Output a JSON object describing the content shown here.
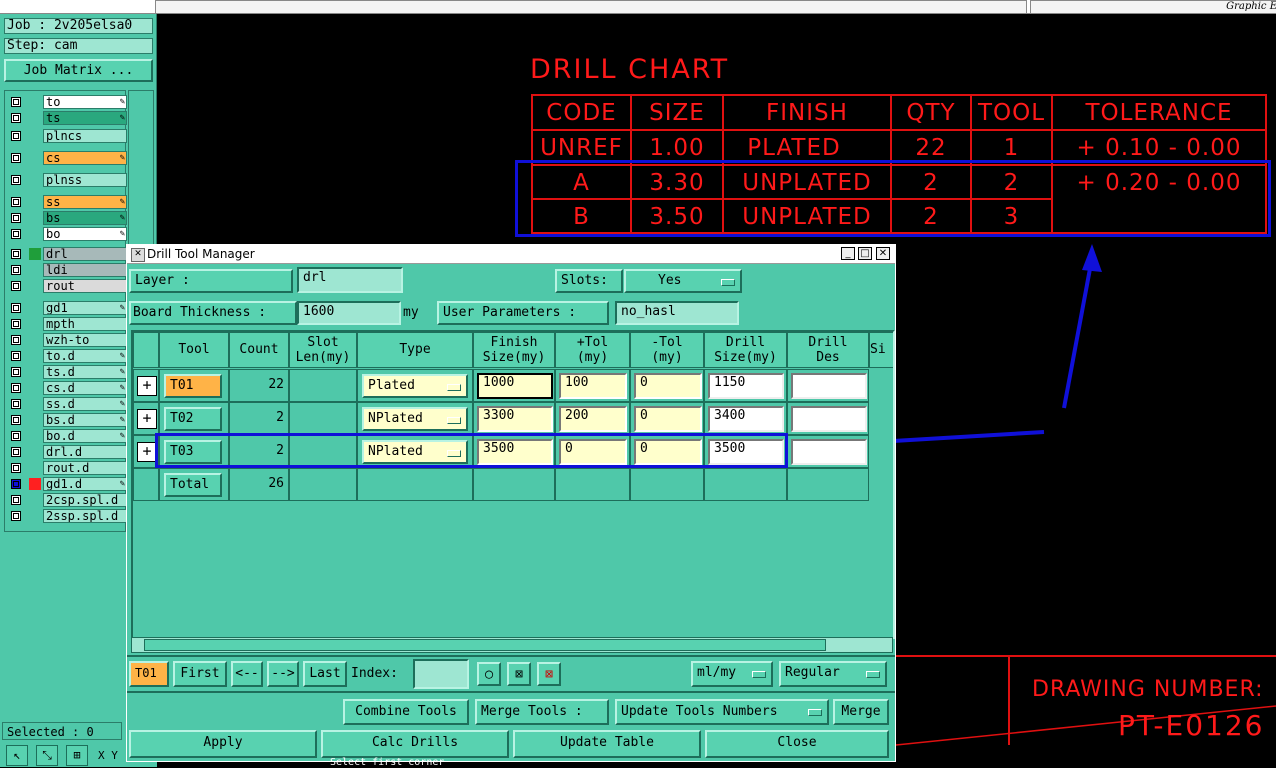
{
  "top": {
    "right_label": "Graphic E"
  },
  "left": {
    "job": "Job : 2v205elsa0",
    "step": "Step: cam",
    "job_matrix": "Job Matrix ...",
    "layers": [
      {
        "name": "to",
        "color": "#ffffff",
        "edit": true
      },
      {
        "name": "ts",
        "color": "#2aa87e",
        "edit": true
      },
      {
        "name": "plncs",
        "color": "#9ee6d2",
        "edit": false
      },
      {
        "name": "cs",
        "color": "#ffb347",
        "edit": true
      },
      {
        "name": "plnss",
        "color": "#9ee6d2",
        "edit": false
      },
      {
        "name": "ss",
        "color": "#ffb347",
        "edit": true
      },
      {
        "name": "bs",
        "color": "#2aa87e",
        "edit": true
      },
      {
        "name": "bo",
        "color": "#ffffff",
        "edit": true
      },
      {
        "name": "drl",
        "color": "#a7b9b9",
        "edit": false
      },
      {
        "name": "ldi",
        "color": "#a7b9b9",
        "edit": false
      },
      {
        "name": "rout",
        "color": "#dadada",
        "edit": false
      },
      {
        "name": "gd1",
        "color": "#9ee6d2",
        "edit": true
      },
      {
        "name": "mpth",
        "color": "#9ee6d2",
        "edit": false
      },
      {
        "name": "wzh-to",
        "color": "#9ee6d2",
        "edit": false
      },
      {
        "name": "to.d",
        "color": "#9ee6d2",
        "edit": true
      },
      {
        "name": "ts.d",
        "color": "#9ee6d2",
        "edit": true
      },
      {
        "name": "cs.d",
        "color": "#9ee6d2",
        "edit": true
      },
      {
        "name": "ss.d",
        "color": "#9ee6d2",
        "edit": true
      },
      {
        "name": "bs.d",
        "color": "#9ee6d2",
        "edit": true
      },
      {
        "name": "bo.d",
        "color": "#9ee6d2",
        "edit": true
      },
      {
        "name": "drl.d",
        "color": "#9ee6d2",
        "edit": false
      },
      {
        "name": "rout.d",
        "color": "#9ee6d2",
        "edit": false
      },
      {
        "name": "gd1.d",
        "color": "#9ee6d2",
        "edit": true
      },
      {
        "name": "2csp.spl.d",
        "color": "#9ee6d2",
        "edit": false
      },
      {
        "name": "2ssp.spl.d",
        "color": "#9ee6d2",
        "edit": false
      }
    ],
    "selected": "Selected : 0",
    "xy_label": "X Y :"
  },
  "chart": {
    "title": "DRILL CHART",
    "headers": [
      "CODE",
      "SIZE",
      "FINISH",
      "QTY",
      "TOOL",
      "TOLERANCE"
    ],
    "rows": [
      [
        "UNREF",
        "1.00",
        "PLATED",
        "22",
        "1",
        "+ 0.10 - 0.00"
      ],
      [
        "A",
        "3.30",
        "UNPLATED",
        "2",
        "2",
        "+ 0.20 - 0.00"
      ],
      [
        "B",
        "3.50",
        "UNPLATED",
        "2",
        "3",
        ""
      ]
    ],
    "drawing_number_label": "DRAWING NUMBER:",
    "drawing_number": "PT-E0126"
  },
  "dialog": {
    "title": "Drill Tool Manager",
    "layer_label": "Layer          :",
    "layer_value": "drl",
    "slots_label": "Slots:",
    "slots_value": "Yes",
    "thickness_label": "Board Thickness :",
    "thickness_value": "1600",
    "thickness_unit": "my",
    "user_params_label": "User Parameters :",
    "user_params_value": "no_hasl",
    "columns": [
      "Tool",
      "Count",
      "Slot\nLen(my)",
      "Type",
      "Finish\nSize(my)",
      "+Tol\n(my)",
      "-Tol\n(my)",
      "Drill\nSize(my)",
      "Drill\nDes",
      "Si"
    ],
    "rows": [
      {
        "tool": "T01",
        "count": "22",
        "slot": "",
        "type": "Plated",
        "finish": "1000",
        "ptol": "100",
        "ntol": "0",
        "drill": "1150",
        "des": ""
      },
      {
        "tool": "T02",
        "count": "2",
        "slot": "",
        "type": "NPlated",
        "finish": "3300",
        "ptol": "200",
        "ntol": "0",
        "drill": "3400",
        "des": ""
      },
      {
        "tool": "T03",
        "count": "2",
        "slot": "",
        "type": "NPlated",
        "finish": "3500",
        "ptol": "0",
        "ntol": "0",
        "drill": "3500",
        "des": ""
      }
    ],
    "total_label": "Total",
    "total_count": "26",
    "current_tool": "T01",
    "nav": {
      "first": "First",
      "prev": "<--",
      "next": "-->",
      "last": "Last",
      "index_label": "Index:"
    },
    "units": "ml/my",
    "mode": "Regular",
    "combine_tools": "Combine Tools",
    "merge_tools_label": "Merge Tools :",
    "update_tools_numbers": "Update Tools Numbers",
    "merge": "Merge",
    "apply": "Apply",
    "calc_drills": "Calc Drills",
    "update_table": "Update Table",
    "close": "Close"
  },
  "status_message": "Select first corner"
}
